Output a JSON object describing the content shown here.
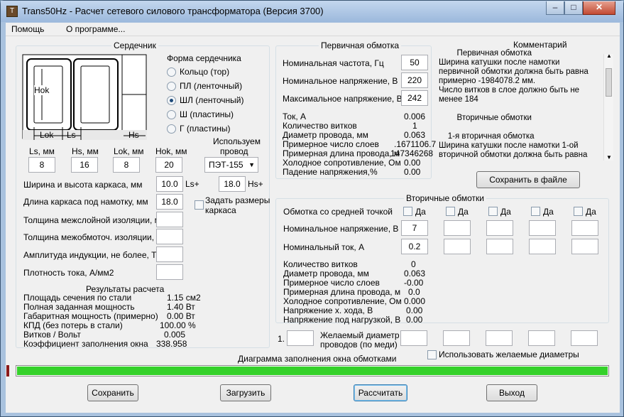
{
  "window": {
    "title": "Trans50Hz - Расчет сетевого силового трансформатора (Версия 3700)",
    "icon": "T"
  },
  "titlebar_buttons": {
    "minimize": "–",
    "maximize": "□",
    "close": "✕"
  },
  "menu": {
    "help": "Помощь",
    "about": "О программе..."
  },
  "core": {
    "title": "Сердечник",
    "diagram_labels": {
      "hok": "Hok",
      "lok": "Lok",
      "ls": "Ls",
      "hs": "Hs"
    },
    "shape_title": "Форма сердечника",
    "shapes": [
      "Кольцо  (тор)",
      "ПЛ  (ленточный)",
      "ШЛ  (ленточный)",
      "Ш  (пластины)",
      "Г (пластины)"
    ],
    "selected_shape_index": 2,
    "dims": [
      {
        "label": "Ls, мм",
        "value": "8"
      },
      {
        "label": "Hs, мм",
        "value": "16"
      },
      {
        "label": "Lok, мм",
        "value": "8"
      },
      {
        "label": "Hok, мм",
        "value": "20"
      }
    ],
    "wire_label_1": "Используем",
    "wire_label_2": "провод",
    "wire_selected": "ПЭТ-155",
    "params": [
      {
        "label": "Ширина и высота каркаса, мм",
        "value": "10.0"
      },
      {
        "label": "Длина каркаса под намотку, мм",
        "value": "18.0"
      },
      {
        "label": "Толщина межслойной изоляции, мм",
        "value": ""
      },
      {
        "label": "Толщина межобмоточ. изоляции, мм",
        "value": ""
      },
      {
        "label": "Амплитуда индукции, не более, Тл",
        "value": ""
      },
      {
        "label": "Плотность тока, А/мм2",
        "value": ""
      }
    ],
    "ls_plus": "Ls+",
    "hs_value": "18.0",
    "hs_plus": "Hs+",
    "frame_check_1": "Задать размеры",
    "frame_check_2": "каркаса",
    "results_title": "Результаты расчета",
    "results": [
      {
        "label": "Площадь сечения по стали",
        "value": "1.15 см2"
      },
      {
        "label": "Полная заданная мощность",
        "value": "1.40 Вт"
      },
      {
        "label": "Габаритная мощность (примерно)",
        "value": "0.00 Вт"
      },
      {
        "label": "КПД (без потерь в стали)",
        "value": "100.00 %"
      },
      {
        "label": "Витков / Вольт",
        "value": "0.005"
      },
      {
        "label": "Коэффициент заполнения окна",
        "value": "338.958"
      }
    ]
  },
  "primary": {
    "title": "Первичная обмотка",
    "inputs": [
      {
        "label": "Номинальная частота, Гц",
        "value": "50"
      },
      {
        "label": "Номинальное напряжение, В",
        "value": "220"
      },
      {
        "label": "Максимальное напряжение, В",
        "value": "242"
      }
    ],
    "results": [
      {
        "label": "Ток, А",
        "value": "0.006"
      },
      {
        "label": "Количество витков",
        "value": "1"
      },
      {
        "label": "Диаметр провода, мм",
        "value": "0.063"
      },
      {
        "label": "Примерное число слоев",
        "value": ".1671106.7"
      },
      {
        "label": "Примерная длина провода, м",
        "value": "147346268"
      },
      {
        "label": "Холодное сопротивление, Ом",
        "value": "0.00"
      },
      {
        "label": "Падение напряжения,%",
        "value": "0.00"
      }
    ]
  },
  "comment": {
    "title": "Комментарий",
    "lines": [
      "        Первичная обмотка",
      "Ширина катушки после намотки",
      "первичной обмотки должна быть равна",
      "примерно -1984078.2 мм.",
      "Число витков в слое должно быть не",
      "менее 184",
      "",
      "        Вторичные обмотки",
      "",
      "    1-я вторичная обмотка",
      "Ширина катушки после намотки 1-ой",
      "вторичной обмотки должна быть равна"
    ],
    "save_button": "Сохранить в файле"
  },
  "secondary": {
    "title": "Вторичные обмотки",
    "center_tap_label": "Обмотка со средней точкой",
    "yes_label": "Да",
    "voltage_label": "Номинальное напряжение, В",
    "current_label": "Номинальный ток, А",
    "voltages": [
      "7",
      "",
      "",
      "",
      ""
    ],
    "currents": [
      "0.2",
      "",
      "",
      "",
      ""
    ],
    "results": [
      {
        "label": "Количество витков",
        "value": "0"
      },
      {
        "label": "Диаметр провода, мм",
        "value": "0.063"
      },
      {
        "label": "Примерное число слоев",
        "value": "-0.00"
      },
      {
        "label": "Примерная длина провода, м",
        "value": "0.0"
      },
      {
        "label": "Холодное сопротивление, Ом",
        "value": "0.000"
      },
      {
        "label": "Напряжение х. хода, В",
        "value": "0.00"
      },
      {
        "label": "Напряжение под нагрузкой, В",
        "value": "0.00"
      }
    ]
  },
  "desired": {
    "index": "1.",
    "label_1": "Желаемый диаметр",
    "label_2": "проводов  (по меди)",
    "use_label": "Использовать желаемые диаметры"
  },
  "fill_diagram": {
    "title": "Диаграмма заполнения окна обмотками",
    "fill": 1.0,
    "color": "#35d12a"
  },
  "buttons": {
    "save": "Сохранить",
    "load": "Загрузить",
    "calc": "Рассчитать",
    "exit": "Выход"
  }
}
